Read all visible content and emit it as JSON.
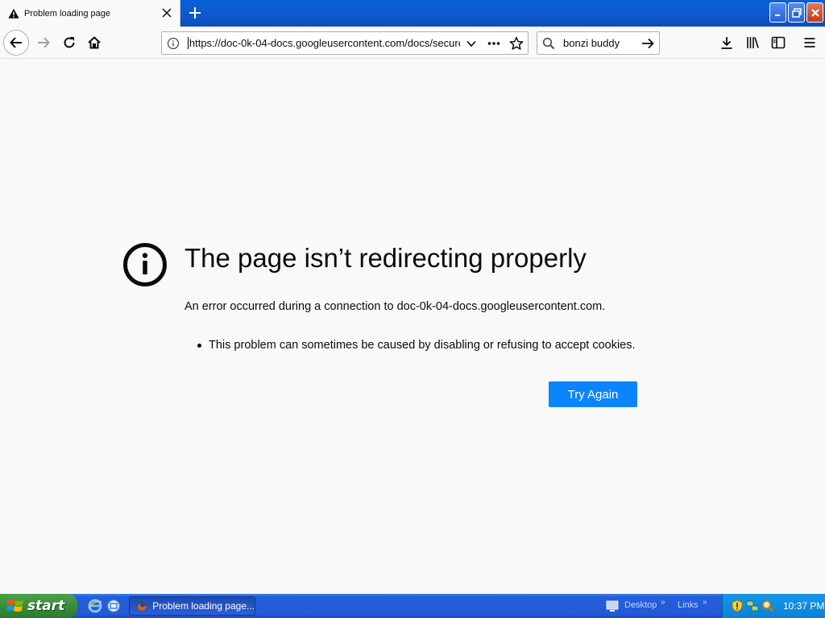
{
  "browser": {
    "tab_title": "Problem loading page",
    "url": "https://doc-0k-04-docs.googleusercontent.com/docs/securesc/",
    "search_query": "bonzi buddy"
  },
  "error_page": {
    "title": "The page isn’t redirecting properly",
    "description": "An error occurred during a connection to doc-0k-04-docs.googleusercontent.com.",
    "reasons": [
      "This problem can sometimes be caused by disabling or refusing to accept cookies."
    ],
    "try_again_label": "Try Again"
  },
  "taskbar": {
    "start_label": "start",
    "task_label": "Problem loading page...",
    "desktop_label": "Desktop",
    "links_label": "Links",
    "clock": "10:37 PM"
  },
  "colors": {
    "accent": "#0a84ff",
    "xp_blue": "#245edc",
    "start_green": "#3a8d3a"
  }
}
